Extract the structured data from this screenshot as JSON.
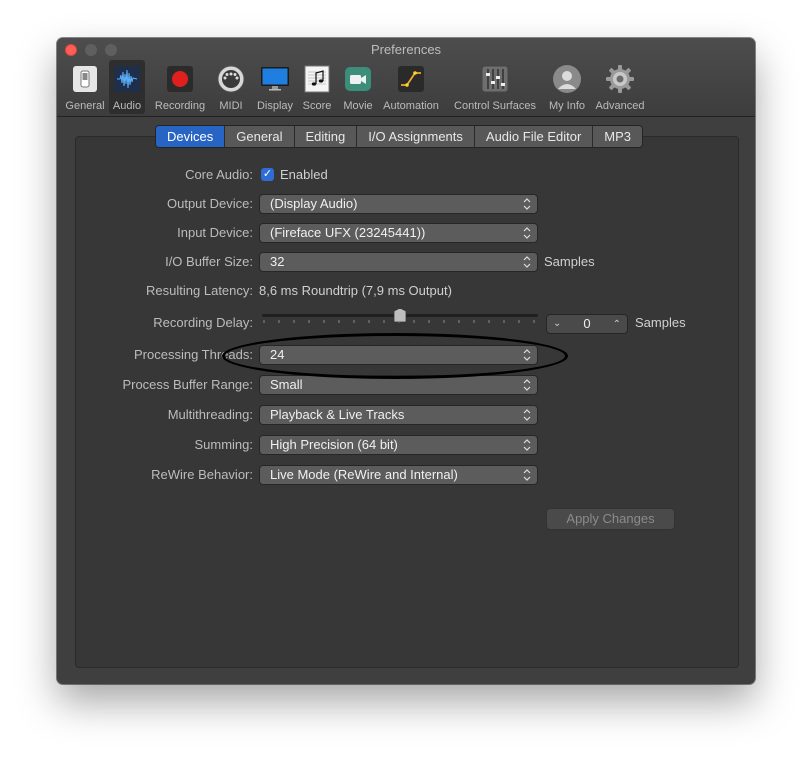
{
  "window": {
    "title": "Preferences"
  },
  "toolbar": {
    "items": [
      {
        "label": "General",
        "icon": "switch-icon"
      },
      {
        "label": "Audio",
        "icon": "waveform-icon",
        "selected": true
      },
      {
        "label": "Recording",
        "icon": "record-icon"
      },
      {
        "label": "MIDI",
        "icon": "midi-connector-icon"
      },
      {
        "label": "Display",
        "icon": "monitor-icon"
      },
      {
        "label": "Score",
        "icon": "score-notes-icon"
      },
      {
        "label": "Movie",
        "icon": "movie-camera-icon"
      },
      {
        "label": "Automation",
        "icon": "automation-curve-icon"
      },
      {
        "label": "Control Surfaces",
        "icon": "faders-icon"
      },
      {
        "label": "My Info",
        "icon": "user-icon"
      },
      {
        "label": "Advanced",
        "icon": "gear-icon"
      }
    ]
  },
  "tabs": [
    {
      "label": "Devices",
      "active": true
    },
    {
      "label": "General"
    },
    {
      "label": "Editing"
    },
    {
      "label": "I/O Assignments"
    },
    {
      "label": "Audio File Editor"
    },
    {
      "label": "MP3"
    }
  ],
  "devices": {
    "core_audio": {
      "label": "Core Audio:",
      "checkbox_label": "Enabled",
      "checked": true
    },
    "output_device": {
      "label": "Output Device:",
      "value": "(Display Audio)"
    },
    "input_device": {
      "label": "Input Device:",
      "value": "(Fireface UFX (23245441))"
    },
    "io_buffer": {
      "label": "I/O Buffer Size:",
      "value": "32",
      "unit": "Samples"
    },
    "latency": {
      "label": "Resulting Latency:",
      "value": "8,6 ms Roundtrip (7,9 ms Output)"
    },
    "recording_delay": {
      "label": "Recording Delay:",
      "value": "0",
      "unit": "Samples",
      "slider_position": 0.5
    },
    "processing_threads": {
      "label": "Processing Threads:",
      "value": "24"
    },
    "process_buffer": {
      "label": "Process Buffer Range:",
      "value": "Small"
    },
    "multithreading": {
      "label": "Multithreading:",
      "value": "Playback & Live Tracks"
    },
    "summing": {
      "label": "Summing:",
      "value": "High Precision (64 bit)"
    },
    "rewire": {
      "label": "ReWire Behavior:",
      "value": "Live Mode (ReWire and Internal)"
    },
    "apply_label": "Apply Changes"
  },
  "colors": {
    "accent": "#2864c3",
    "annotation": "#000000"
  }
}
